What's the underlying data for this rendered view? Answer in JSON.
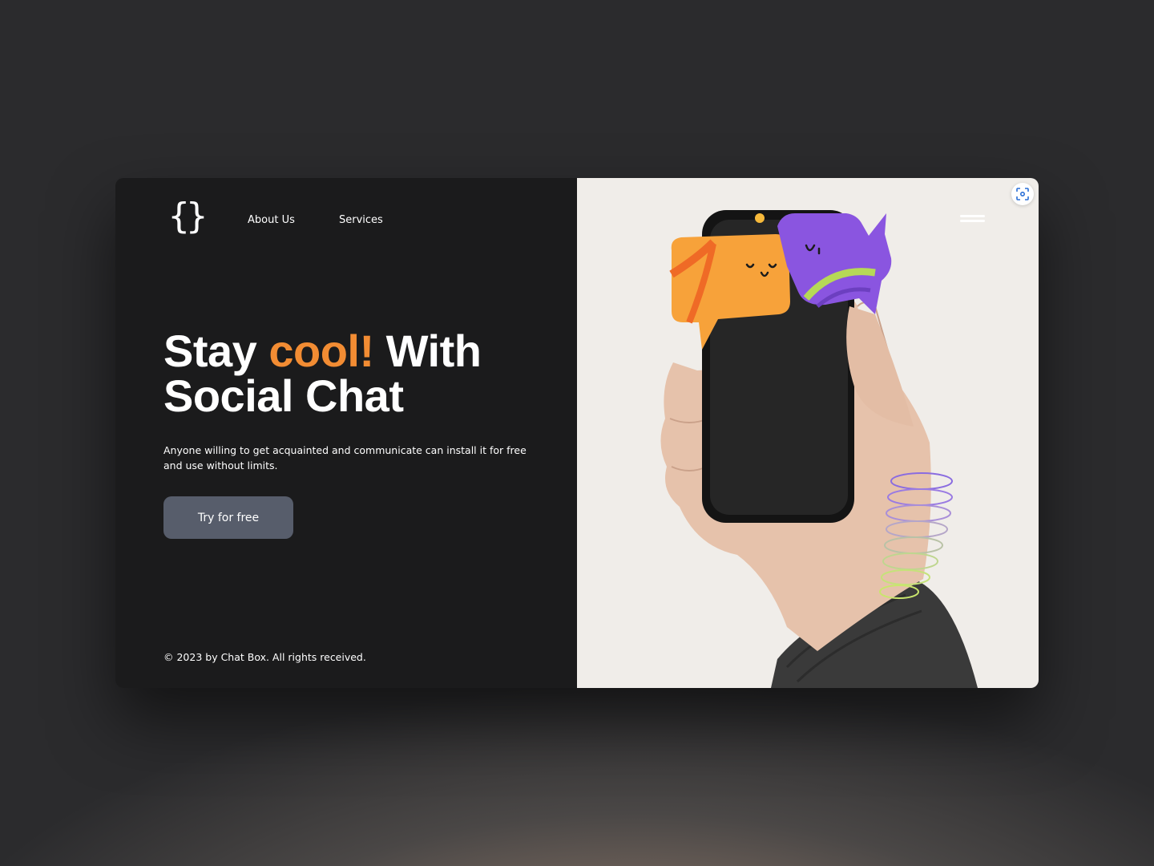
{
  "brand": {
    "logo_text": "{}"
  },
  "nav": {
    "about_label": "About Us",
    "services_label": "Services"
  },
  "hero": {
    "headline_part1": "Stay ",
    "headline_accent": "cool!",
    "headline_part2": " With Social Chat",
    "subtext": "Anyone willing to get acquainted and communicate can install it for free and use without limits.",
    "cta_label": "Try for free"
  },
  "footer": {
    "copyright": "© 2023 by Chat Box. All rights received."
  },
  "icons": {
    "menu": "hamburger-icon",
    "scan": "scan-icon",
    "logo": "curly-braces-logo"
  },
  "colors": {
    "left_panel_bg": "#1b1b1c",
    "right_panel_bg": "#f0ede9",
    "accent": "#f28c33",
    "button_bg": "#575d6b",
    "bubble_orange": "#f7a23a",
    "bubble_purple": "#8a55e0",
    "bubble_green": "#b6d957"
  }
}
